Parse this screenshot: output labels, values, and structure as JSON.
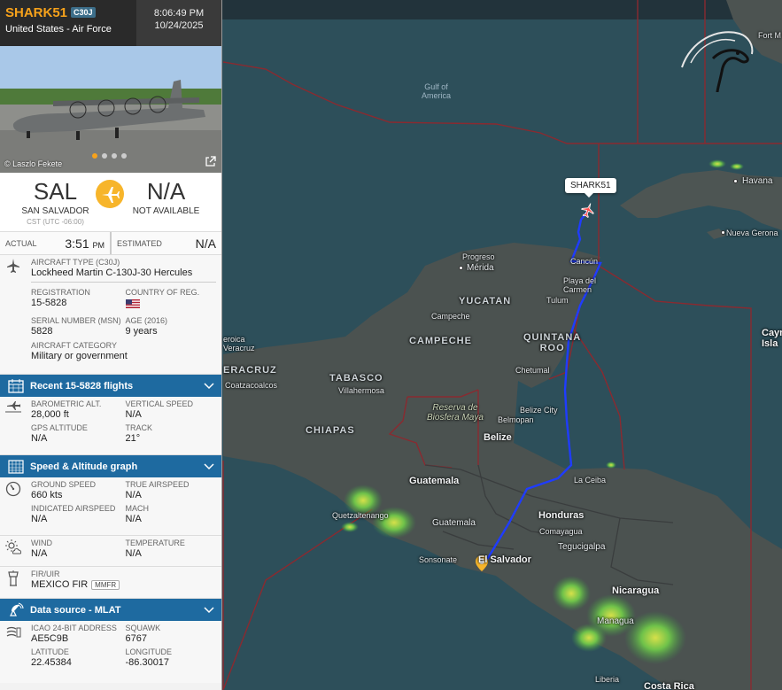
{
  "flight": {
    "callsign": "SHARK51",
    "aircraft_badge": "C30J",
    "operator": "United States - Air Force",
    "time": "8:06:49 PM",
    "date": "10/24/2025"
  },
  "photo": {
    "credit": "© Laszlo Fekete",
    "slide_count": 4,
    "active_slide": 1
  },
  "route": {
    "origin_code": "SAL",
    "origin_name": "SAN SALVADOR",
    "origin_tz": "CST (UTC -06:00)",
    "dest_code": "N/A",
    "dest_name": "NOT AVAILABLE"
  },
  "times": {
    "actual_label": "ACTUAL",
    "actual_value": "3:51",
    "actual_suffix": "PM",
    "estimated_label": "ESTIMATED",
    "estimated_value": "N/A"
  },
  "aircraft": {
    "type_label": "AIRCRAFT TYPE (C30J)",
    "type_value": "Lockheed Martin C-130J-30 Hercules",
    "reg_label": "REGISTRATION",
    "reg_value": "15-5828",
    "country_label": "COUNTRY OF REG.",
    "msn_label": "SERIAL NUMBER (MSN)",
    "msn_value": "5828",
    "age_label": "AGE (2016)",
    "age_value": "9 years",
    "category_label": "AIRCRAFT CATEGORY",
    "category_value": "Military or government"
  },
  "bars": {
    "recent": "Recent 15-5828 flights",
    "graph": "Speed & Altitude graph",
    "source": "Data source - MLAT"
  },
  "altitude": {
    "baro_label": "BAROMETRIC ALT.",
    "baro_value": "28,000 ft",
    "vs_label": "VERTICAL SPEED",
    "vs_value": "N/A",
    "gps_label": "GPS ALTITUDE",
    "gps_value": "N/A",
    "track_label": "TRACK",
    "track_value": "21°"
  },
  "speed": {
    "gs_label": "GROUND SPEED",
    "gs_value": "660 kts",
    "tas_label": "TRUE AIRSPEED",
    "tas_value": "N/A",
    "ias_label": "INDICATED AIRSPEED",
    "ias_value": "N/A",
    "mach_label": "MACH",
    "mach_value": "N/A"
  },
  "weather": {
    "wind_label": "WIND",
    "wind_value": "N/A",
    "temp_label": "TEMPERATURE",
    "temp_value": "N/A"
  },
  "fir": {
    "label": "FIR/UIR",
    "value": "MEXICO FIR",
    "code": "MMFR"
  },
  "source": {
    "icao_label": "ICAO 24-BIT ADDRESS",
    "icao_value": "AE5C9B",
    "squawk_label": "SQUAWK",
    "squawk_value": "6767",
    "lat_label": "LATITUDE",
    "lat_value": "22.45384",
    "lon_label": "LONGITUDE",
    "lon_value": "-86.30017"
  },
  "map_labels": {
    "gulf": "Gulf of\nAmerica",
    "havana": "Havana",
    "nueva_gerona": "Nueva Gerona",
    "cayman": "Cayn\nIsla",
    "progreso": "Progreso",
    "merida": "Mérida",
    "cancun": "Cancún",
    "playa": "Playa del\nCarmen",
    "tulum": "Tulum",
    "yucatan": "YUCATAN",
    "campeche_city": "Campeche",
    "campeche": "CAMPECHE",
    "quintana_roo": "QUINTANA\nROO",
    "chetumal": "Chetumal",
    "tabasco": "TABASCO",
    "villahermosa": "Villahermosa",
    "coatzacoalcos": "Coatzacoalcos",
    "veracruz": "ERACRUZ",
    "heroica": "eroica\nVeracruz",
    "chiapas": "CHIAPAS",
    "biosfera": "Reserva de\nBiosfera Maya",
    "belmopan": "Belmopan",
    "belize_city": "Belize City",
    "belize": "Belize",
    "guatemala": "Guatemala",
    "guatemala_city": "Guatemala",
    "quetzaltenango": "Quetzaltenango",
    "la_ceiba": "La Ceiba",
    "honduras": "Honduras",
    "comayagua": "Comayagua",
    "tegucigalpa": "Tegucigalpa",
    "el_salvador": "El Salvador",
    "sonsonate": "Sonsonate",
    "nicaragua": "Nicaragua",
    "managua": "Managua",
    "costa_rica": "Costa Rica",
    "liberia": "Liberia",
    "fort_myers": "Fort M",
    "aircraft_tag": "SHARK51"
  },
  "colors": {
    "accent": "#f7a21b",
    "bar_blue": "#1e6aa0",
    "track": "#1f3cff",
    "sea": "#2b4f5a",
    "land": "#4a5250"
  }
}
